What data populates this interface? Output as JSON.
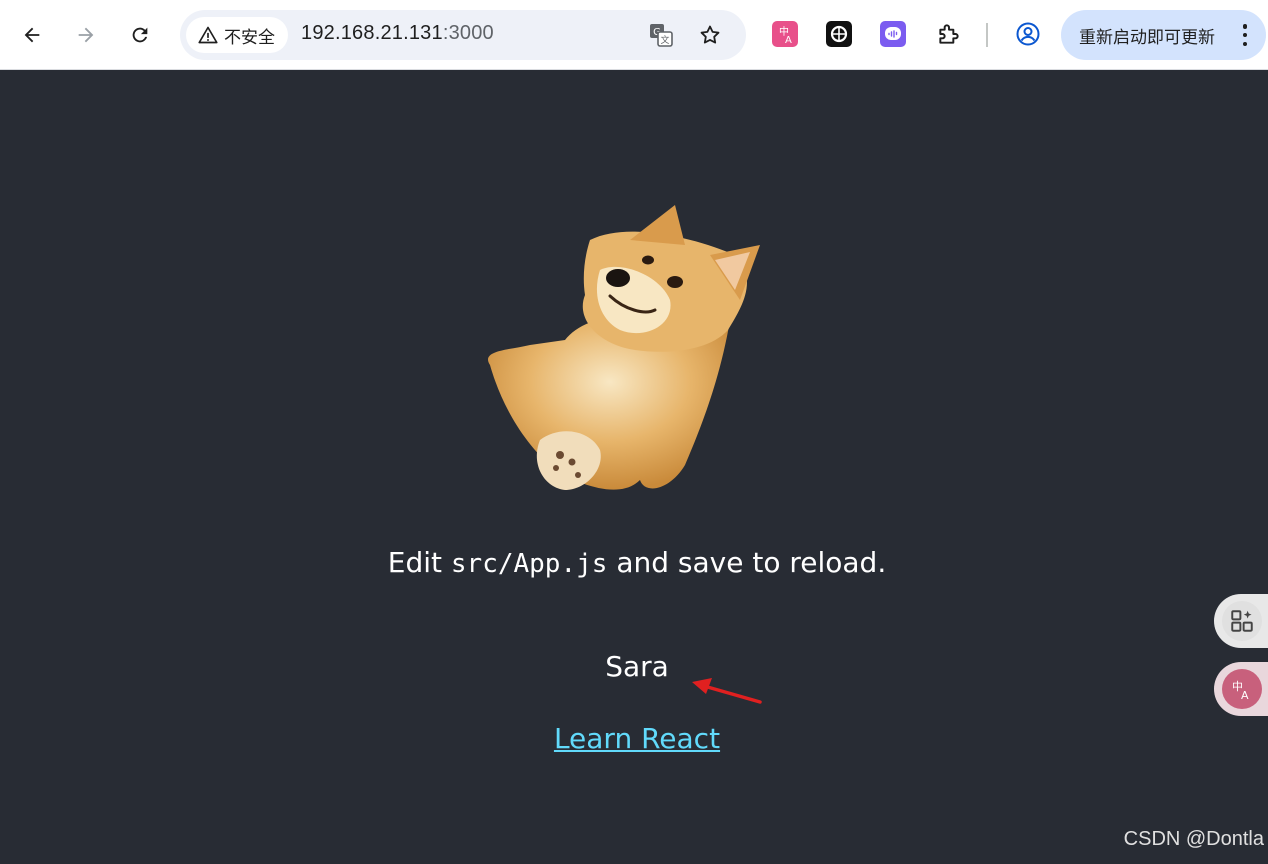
{
  "browser": {
    "security_label": "不安全",
    "url_host": "192.168.21.131",
    "url_port": ":3000",
    "update_label": "重新启动即可更新",
    "colors": {
      "toolbar_bg": "#ffffff",
      "omnibox_bg": "#eef1f8",
      "update_bg": "#d3e3fd"
    }
  },
  "icons": {
    "back": "arrow-left-icon",
    "forward": "arrow-right-icon",
    "reload": "reload-icon",
    "warning": "warning-triangle-icon",
    "translate": "translate-icon",
    "bookmark": "star-icon",
    "ext1": "translate-extension-icon",
    "ext2": "chatgpt-extension-icon",
    "ext3": "voice-extension-icon",
    "ext4": "puzzle-icon",
    "profile": "profile-icon",
    "menu": "kebab-menu-icon"
  },
  "page": {
    "edit_prefix": "Edit ",
    "edit_code": "src/App.js",
    "edit_suffix": " and save to reload.",
    "name": "Sara",
    "link_label": "Learn React",
    "colors": {
      "background": "#282c34",
      "text": "#ffffff",
      "link": "#61dafb",
      "arrow": "#e02020"
    }
  },
  "watermark": "CSDN @Dontla"
}
